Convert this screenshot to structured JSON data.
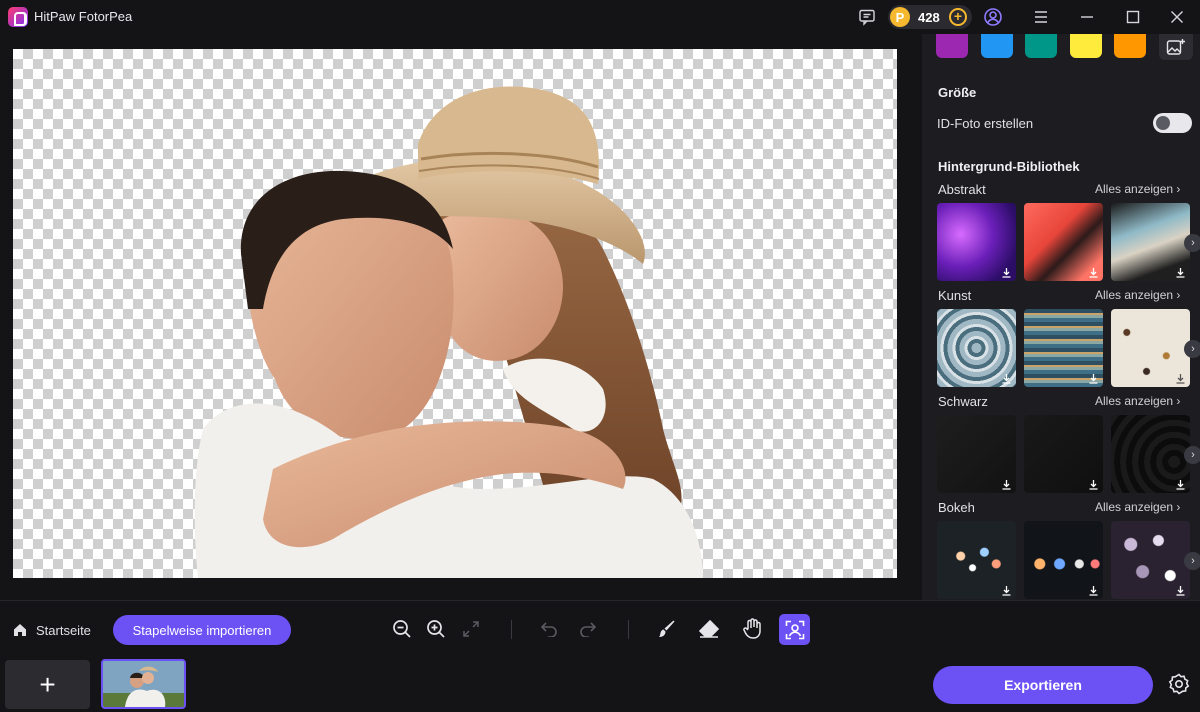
{
  "app": {
    "title": "HitPaw FotorPea"
  },
  "titlebar": {
    "credits": "428"
  },
  "panel": {
    "swatches": [
      "#9c27b0",
      "#2196f3",
      "#009688",
      "#ffeb3b",
      "#ff9800"
    ],
    "size_title": "Größe",
    "id_photo_label": "ID-Foto erstellen",
    "id_photo_enabled": false,
    "library_title": "Hintergrund-Bibliothek",
    "categories": [
      {
        "name": "Abstrakt",
        "see_all": "Alles anzeigen"
      },
      {
        "name": "Kunst",
        "see_all": "Alles anzeigen"
      },
      {
        "name": "Schwarz",
        "see_all": "Alles anzeigen"
      },
      {
        "name": "Bokeh",
        "see_all": "Alles anzeigen"
      }
    ]
  },
  "toolbar": {
    "home_label": "Startseite",
    "batch_import_label": "Stapelweise importieren"
  },
  "footer": {
    "add_label": "+",
    "export_label": "Exportieren"
  }
}
